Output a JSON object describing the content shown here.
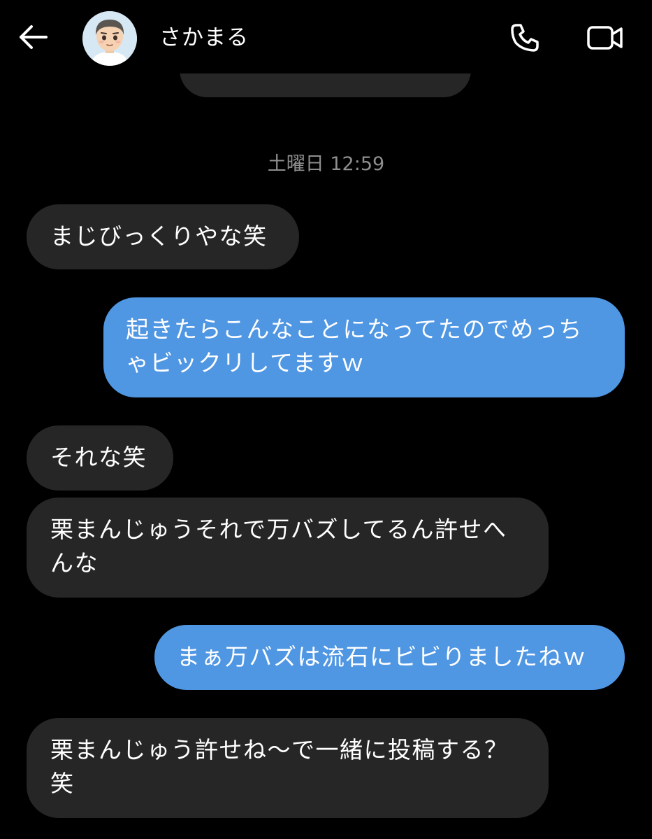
{
  "header": {
    "contact_name": "さかまる",
    "icons": {
      "back": "arrow-left-icon",
      "call": "phone-icon",
      "video": "video-camera-icon"
    }
  },
  "conversation": {
    "timestamp": "土曜日 12:59",
    "messages": [
      {
        "direction": "incoming",
        "text": "まじびっくりやな笑"
      },
      {
        "direction": "outgoing",
        "text": "起きたらこんなことになってたのでめっちゃビックリしてますｗ"
      },
      {
        "direction": "incoming",
        "text": "それな笑"
      },
      {
        "direction": "incoming",
        "text": "栗まんじゅうそれで万バズしてるん許せへんな"
      },
      {
        "direction": "outgoing",
        "text": "まぁ万バズは流石にビビりましたねｗ"
      },
      {
        "direction": "incoming",
        "text": "栗まんじゅう許せね〜で一緒に投稿する？笑"
      }
    ]
  },
  "colors": {
    "background": "#000000",
    "incoming_bubble": "#262626",
    "outgoing_bubble": "#4f96e3",
    "timestamp": "#8e8e8e",
    "text": "#ffffff"
  }
}
